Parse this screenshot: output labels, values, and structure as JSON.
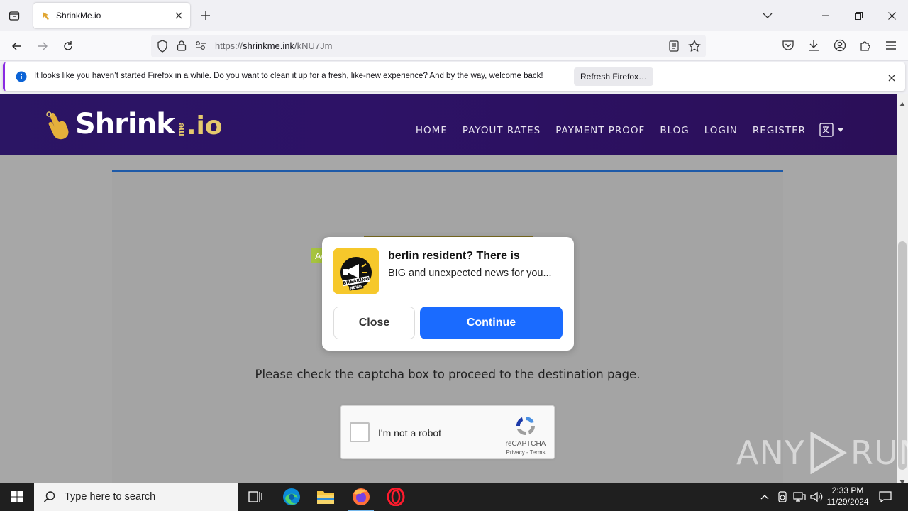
{
  "browser": {
    "tab": {
      "title": "ShrinkMe.io"
    },
    "url": {
      "prefix": "https://",
      "host": "shrinkme.ink",
      "path": "/kNU7Jm"
    }
  },
  "notification": {
    "message": "It looks like you haven’t started Firefox in a while. Do you want to clean it up for a fresh, like-new experience? And by the way, welcome back!",
    "button_label": "Refresh Firefox…"
  },
  "site": {
    "logo": {
      "main": "Shrink",
      "me": "me",
      "tld": ".io"
    },
    "nav": [
      "HOME",
      "PAYOUT RATES",
      "PAYMENT PROOF",
      "BLOG",
      "LOGIN",
      "REGISTER"
    ],
    "captcha_message": "Please check the captcha box to proceed to the destination page.",
    "recaptcha": {
      "label": "I'm not a robot",
      "brand": "reCAPTCHA",
      "links": "Privacy - Terms"
    }
  },
  "ad": {
    "badge": "Ad",
    "title": "berlin resident? There is",
    "body": "BIG and unexpected news for you...",
    "icon_text_top": "BREAKING",
    "icon_text_bottom": "NEWS",
    "close_label": "Close",
    "continue_label": "Continue"
  },
  "watermark": {
    "left": "ANY",
    "right": "RUN"
  },
  "taskbar": {
    "search_placeholder": "Type here to search",
    "time": "2:33 PM",
    "date": "11/29/2024"
  },
  "colors": {
    "header_bg": "#2b1564",
    "accent_gold": "#e5c96d",
    "continue_blue": "#1a6bff",
    "ad_badge": "#a6c33e"
  }
}
